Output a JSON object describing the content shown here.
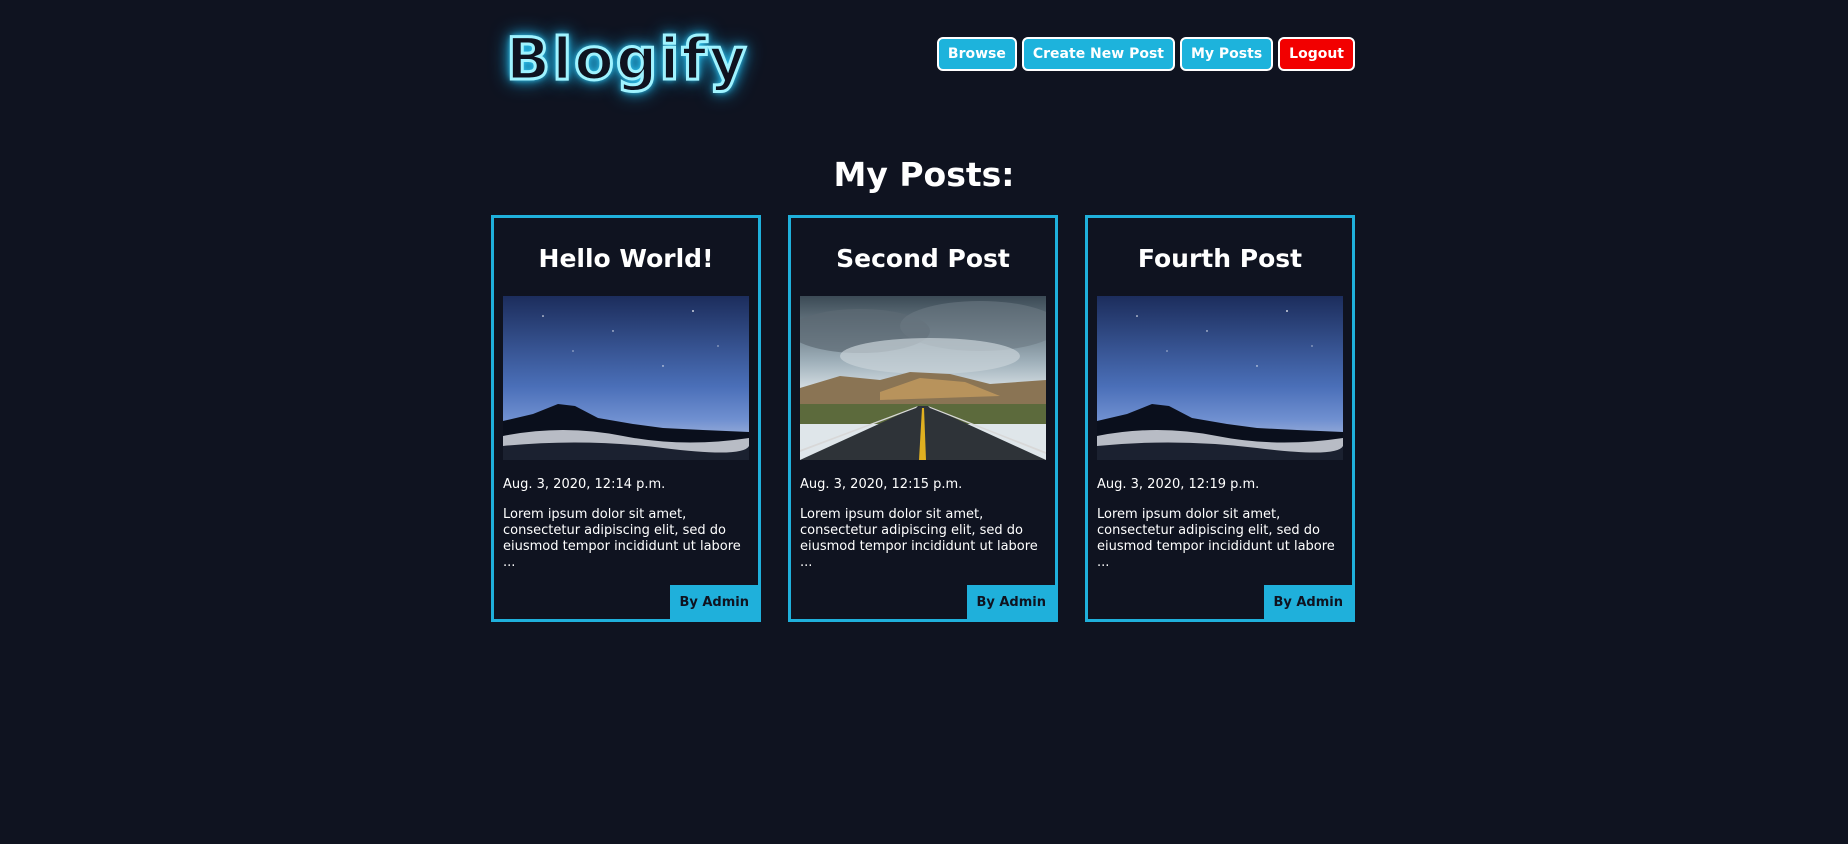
{
  "brand": {
    "logo_text": "Blogify",
    "accent": "#1db3dc",
    "danger": "#f20000",
    "background": "#0f1320"
  },
  "nav": {
    "browse": "Browse",
    "create": "Create New Post",
    "my_posts": "My Posts",
    "logout": "Logout"
  },
  "page": {
    "title": "My Posts:"
  },
  "posts": [
    {
      "title": "Hello World!",
      "image": "night-sky-mountain",
      "date": "Aug. 3, 2020, 12:14 p.m.",
      "excerpt": "Lorem ipsum dolor sit amet, consectetur adipiscing elit, sed do eiusmod tempor incididunt ut labore ...",
      "author": "By Admin"
    },
    {
      "title": "Second Post",
      "image": "road-clouds",
      "date": "Aug. 3, 2020, 12:15 p.m.",
      "excerpt": "Lorem ipsum dolor sit amet, consectetur adipiscing elit, sed do eiusmod tempor incididunt ut labore ...",
      "author": "By Admin"
    },
    {
      "title": "Fourth Post",
      "image": "night-sky-mountain",
      "date": "Aug. 3, 2020, 12:19 p.m.",
      "excerpt": "Lorem ipsum dolor sit amet, consectetur adipiscing elit, sed do eiusmod tempor incididunt ut labore ...",
      "author": "By Admin"
    }
  ]
}
